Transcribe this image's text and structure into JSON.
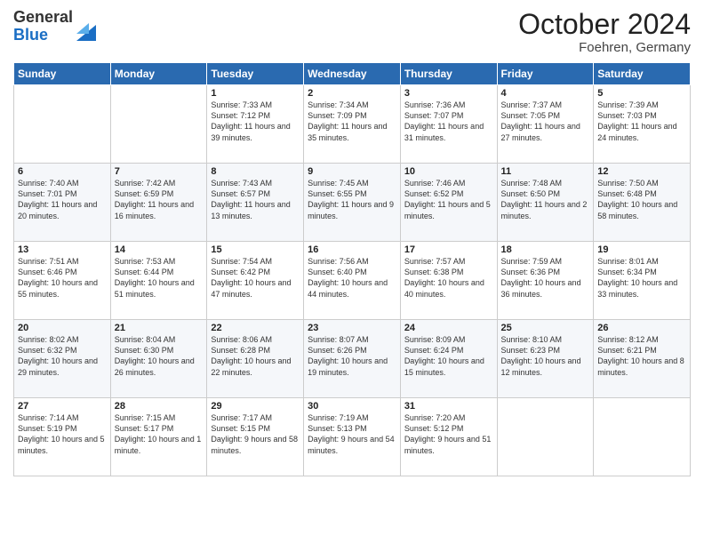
{
  "header": {
    "logo_general": "General",
    "logo_blue": "Blue",
    "month_title": "October 2024",
    "location": "Foehren, Germany"
  },
  "days_of_week": [
    "Sunday",
    "Monday",
    "Tuesday",
    "Wednesday",
    "Thursday",
    "Friday",
    "Saturday"
  ],
  "weeks": [
    [
      {
        "day": "",
        "sunrise": "",
        "sunset": "",
        "daylight": ""
      },
      {
        "day": "",
        "sunrise": "",
        "sunset": "",
        "daylight": ""
      },
      {
        "day": "1",
        "sunrise": "Sunrise: 7:33 AM",
        "sunset": "Sunset: 7:12 PM",
        "daylight": "Daylight: 11 hours and 39 minutes."
      },
      {
        "day": "2",
        "sunrise": "Sunrise: 7:34 AM",
        "sunset": "Sunset: 7:09 PM",
        "daylight": "Daylight: 11 hours and 35 minutes."
      },
      {
        "day": "3",
        "sunrise": "Sunrise: 7:36 AM",
        "sunset": "Sunset: 7:07 PM",
        "daylight": "Daylight: 11 hours and 31 minutes."
      },
      {
        "day": "4",
        "sunrise": "Sunrise: 7:37 AM",
        "sunset": "Sunset: 7:05 PM",
        "daylight": "Daylight: 11 hours and 27 minutes."
      },
      {
        "day": "5",
        "sunrise": "Sunrise: 7:39 AM",
        "sunset": "Sunset: 7:03 PM",
        "daylight": "Daylight: 11 hours and 24 minutes."
      }
    ],
    [
      {
        "day": "6",
        "sunrise": "Sunrise: 7:40 AM",
        "sunset": "Sunset: 7:01 PM",
        "daylight": "Daylight: 11 hours and 20 minutes."
      },
      {
        "day": "7",
        "sunrise": "Sunrise: 7:42 AM",
        "sunset": "Sunset: 6:59 PM",
        "daylight": "Daylight: 11 hours and 16 minutes."
      },
      {
        "day": "8",
        "sunrise": "Sunrise: 7:43 AM",
        "sunset": "Sunset: 6:57 PM",
        "daylight": "Daylight: 11 hours and 13 minutes."
      },
      {
        "day": "9",
        "sunrise": "Sunrise: 7:45 AM",
        "sunset": "Sunset: 6:55 PM",
        "daylight": "Daylight: 11 hours and 9 minutes."
      },
      {
        "day": "10",
        "sunrise": "Sunrise: 7:46 AM",
        "sunset": "Sunset: 6:52 PM",
        "daylight": "Daylight: 11 hours and 5 minutes."
      },
      {
        "day": "11",
        "sunrise": "Sunrise: 7:48 AM",
        "sunset": "Sunset: 6:50 PM",
        "daylight": "Daylight: 11 hours and 2 minutes."
      },
      {
        "day": "12",
        "sunrise": "Sunrise: 7:50 AM",
        "sunset": "Sunset: 6:48 PM",
        "daylight": "Daylight: 10 hours and 58 minutes."
      }
    ],
    [
      {
        "day": "13",
        "sunrise": "Sunrise: 7:51 AM",
        "sunset": "Sunset: 6:46 PM",
        "daylight": "Daylight: 10 hours and 55 minutes."
      },
      {
        "day": "14",
        "sunrise": "Sunrise: 7:53 AM",
        "sunset": "Sunset: 6:44 PM",
        "daylight": "Daylight: 10 hours and 51 minutes."
      },
      {
        "day": "15",
        "sunrise": "Sunrise: 7:54 AM",
        "sunset": "Sunset: 6:42 PM",
        "daylight": "Daylight: 10 hours and 47 minutes."
      },
      {
        "day": "16",
        "sunrise": "Sunrise: 7:56 AM",
        "sunset": "Sunset: 6:40 PM",
        "daylight": "Daylight: 10 hours and 44 minutes."
      },
      {
        "day": "17",
        "sunrise": "Sunrise: 7:57 AM",
        "sunset": "Sunset: 6:38 PM",
        "daylight": "Daylight: 10 hours and 40 minutes."
      },
      {
        "day": "18",
        "sunrise": "Sunrise: 7:59 AM",
        "sunset": "Sunset: 6:36 PM",
        "daylight": "Daylight: 10 hours and 36 minutes."
      },
      {
        "day": "19",
        "sunrise": "Sunrise: 8:01 AM",
        "sunset": "Sunset: 6:34 PM",
        "daylight": "Daylight: 10 hours and 33 minutes."
      }
    ],
    [
      {
        "day": "20",
        "sunrise": "Sunrise: 8:02 AM",
        "sunset": "Sunset: 6:32 PM",
        "daylight": "Daylight: 10 hours and 29 minutes."
      },
      {
        "day": "21",
        "sunrise": "Sunrise: 8:04 AM",
        "sunset": "Sunset: 6:30 PM",
        "daylight": "Daylight: 10 hours and 26 minutes."
      },
      {
        "day": "22",
        "sunrise": "Sunrise: 8:06 AM",
        "sunset": "Sunset: 6:28 PM",
        "daylight": "Daylight: 10 hours and 22 minutes."
      },
      {
        "day": "23",
        "sunrise": "Sunrise: 8:07 AM",
        "sunset": "Sunset: 6:26 PM",
        "daylight": "Daylight: 10 hours and 19 minutes."
      },
      {
        "day": "24",
        "sunrise": "Sunrise: 8:09 AM",
        "sunset": "Sunset: 6:24 PM",
        "daylight": "Daylight: 10 hours and 15 minutes."
      },
      {
        "day": "25",
        "sunrise": "Sunrise: 8:10 AM",
        "sunset": "Sunset: 6:23 PM",
        "daylight": "Daylight: 10 hours and 12 minutes."
      },
      {
        "day": "26",
        "sunrise": "Sunrise: 8:12 AM",
        "sunset": "Sunset: 6:21 PM",
        "daylight": "Daylight: 10 hours and 8 minutes."
      }
    ],
    [
      {
        "day": "27",
        "sunrise": "Sunrise: 7:14 AM",
        "sunset": "Sunset: 5:19 PM",
        "daylight": "Daylight: 10 hours and 5 minutes."
      },
      {
        "day": "28",
        "sunrise": "Sunrise: 7:15 AM",
        "sunset": "Sunset: 5:17 PM",
        "daylight": "Daylight: 10 hours and 1 minute."
      },
      {
        "day": "29",
        "sunrise": "Sunrise: 7:17 AM",
        "sunset": "Sunset: 5:15 PM",
        "daylight": "Daylight: 9 hours and 58 minutes."
      },
      {
        "day": "30",
        "sunrise": "Sunrise: 7:19 AM",
        "sunset": "Sunset: 5:13 PM",
        "daylight": "Daylight: 9 hours and 54 minutes."
      },
      {
        "day": "31",
        "sunrise": "Sunrise: 7:20 AM",
        "sunset": "Sunset: 5:12 PM",
        "daylight": "Daylight: 9 hours and 51 minutes."
      },
      {
        "day": "",
        "sunrise": "",
        "sunset": "",
        "daylight": ""
      },
      {
        "day": "",
        "sunrise": "",
        "sunset": "",
        "daylight": ""
      }
    ]
  ]
}
